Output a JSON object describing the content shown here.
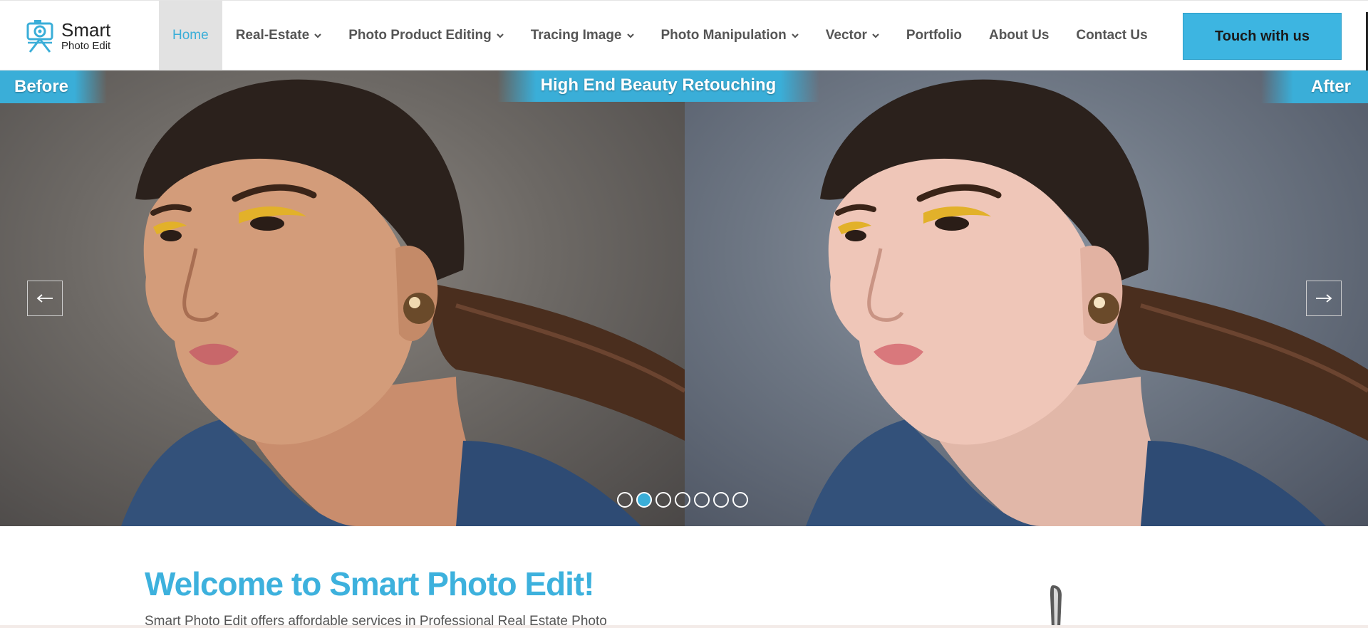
{
  "brand": {
    "title": "Smart",
    "subtitle": "Photo Edit",
    "accent_color": "#3db5e1"
  },
  "nav": {
    "items": [
      {
        "label": "Home",
        "active": true,
        "has_dropdown": false
      },
      {
        "label": "Real-Estate",
        "active": false,
        "has_dropdown": true
      },
      {
        "label": "Photo Product Editing",
        "active": false,
        "has_dropdown": true
      },
      {
        "label": "Tracing Image",
        "active": false,
        "has_dropdown": true
      },
      {
        "label": "Photo Manipulation",
        "active": false,
        "has_dropdown": true
      },
      {
        "label": "Vector",
        "active": false,
        "has_dropdown": true
      },
      {
        "label": "Portfolio",
        "active": false,
        "has_dropdown": false
      },
      {
        "label": "About Us",
        "active": false,
        "has_dropdown": false
      },
      {
        "label": "Contact Us",
        "active": false,
        "has_dropdown": false
      }
    ],
    "cta_label": "Touch with us"
  },
  "hero": {
    "before_label": "Before",
    "title": "High End Beauty Retouching",
    "after_label": "After",
    "prev_icon": "arrow-left-icon",
    "next_icon": "arrow-right-icon",
    "slide_count": 7,
    "active_slide": 2
  },
  "welcome": {
    "title": "Welcome to Smart Photo Edit!",
    "text": "Smart Photo Edit offers affordable services in Professional Real Estate Photo"
  }
}
